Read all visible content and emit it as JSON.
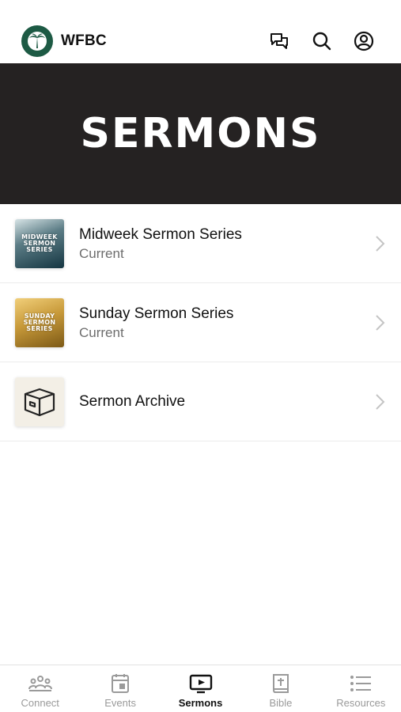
{
  "header": {
    "brand": "WFBC",
    "icons": [
      "chat-icon",
      "search-icon",
      "account-icon"
    ]
  },
  "banner": {
    "title": "SERMONS"
  },
  "list": [
    {
      "title": "Midweek Sermon Series",
      "subtitle": "Current",
      "thumb_text": [
        "MIDWEEK",
        "SERMON",
        "SERIES"
      ]
    },
    {
      "title": "Sunday Sermon Series",
      "subtitle": "Current",
      "thumb_text": [
        "SUNDAY",
        "SERMON",
        "SERIES"
      ]
    },
    {
      "title": "Sermon Archive",
      "subtitle": "",
      "thumb_icon": "archive-box-icon"
    }
  ],
  "tabs": [
    {
      "label": "Connect",
      "icon": "people-icon",
      "active": false
    },
    {
      "label": "Events",
      "icon": "calendar-icon",
      "active": false
    },
    {
      "label": "Sermons",
      "icon": "tv-play-icon",
      "active": true
    },
    {
      "label": "Bible",
      "icon": "bible-icon",
      "active": false
    },
    {
      "label": "Resources",
      "icon": "list-icon",
      "active": false
    }
  ],
  "colors": {
    "brand_green": "#1d5a44",
    "banner_bg": "#252222",
    "inactive_tab": "#9a9a9a",
    "active_tab": "#111111"
  }
}
